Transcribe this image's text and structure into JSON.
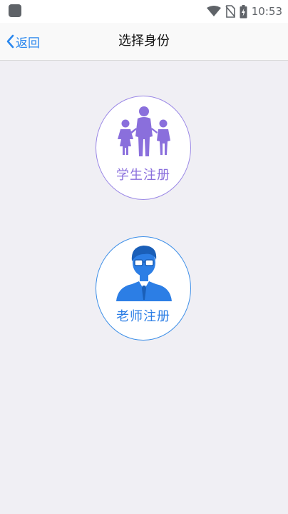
{
  "status_bar": {
    "time": "10:53",
    "icons": [
      "notification-square-icon",
      "wifi-icon",
      "no-sim-icon",
      "battery-icon"
    ]
  },
  "nav": {
    "back_label": "返回",
    "title": "选择身份"
  },
  "roles": {
    "student": {
      "label": "学生注册",
      "icon": "family-icon",
      "color": "#8a6fdc"
    },
    "teacher": {
      "label": "老师注册",
      "icon": "teacher-avatar-icon",
      "color": "#2c7ee5"
    }
  },
  "colors": {
    "accent": "#2b88ee",
    "background": "#f0eff4"
  }
}
